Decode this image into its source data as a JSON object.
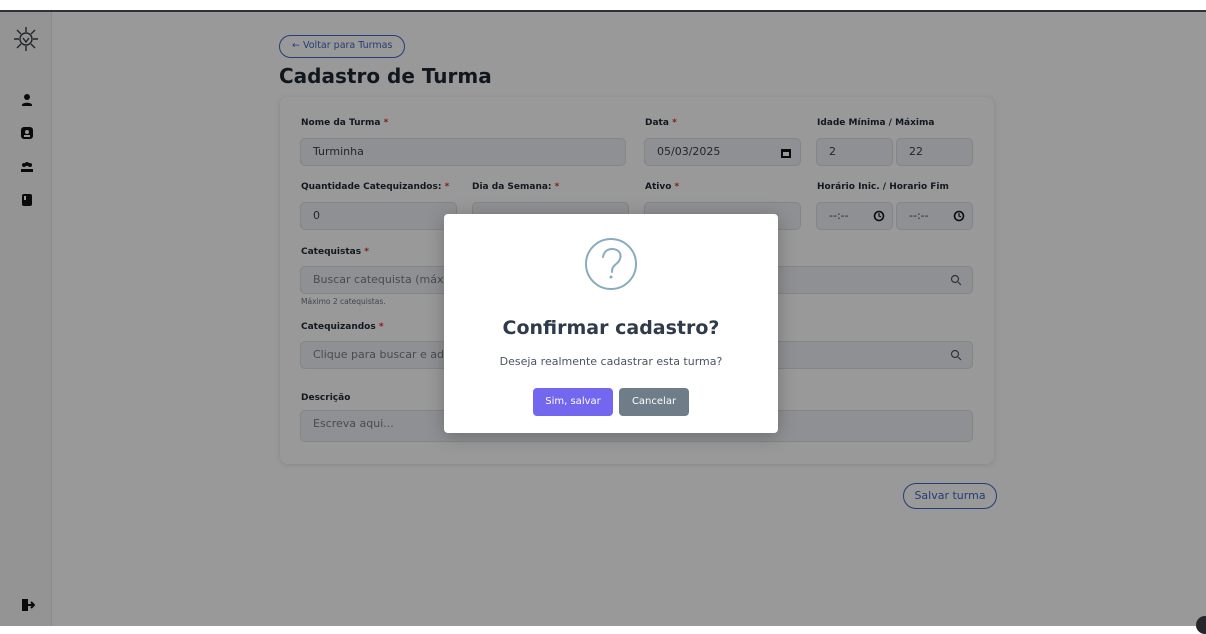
{
  "page": {
    "back_label": "← Voltar para Turmas",
    "title": "Cadastro de Turma",
    "save_label": "Salvar turma"
  },
  "form": {
    "nome": {
      "label": "Nome da Turma",
      "value": "Turminha"
    },
    "data": {
      "label": "Data",
      "value": "05/03/2025"
    },
    "idade": {
      "label": "Idade Mínima / Máxima",
      "min_value": "2",
      "max_value": "22"
    },
    "quantidade": {
      "label": "Quantidade Catequizandos:",
      "value": "0"
    },
    "dia": {
      "label": "Dia da Semana:",
      "value": ""
    },
    "ativo": {
      "label": "Ativo",
      "value": ""
    },
    "horario": {
      "label": "Horário Inic. / Horario Fim",
      "start_value": "--:--",
      "end_value": "--:--"
    },
    "catequistas": {
      "label": "Catequistas",
      "placeholder": "Buscar catequista (máx 2)",
      "hint": "Máximo 2 catequistas."
    },
    "catequizandos": {
      "label": "Catequizandos",
      "placeholder": "Clique para buscar e adicionar"
    },
    "descricao": {
      "label": "Descrição",
      "placeholder": "Escreva aqui..."
    },
    "required_marker": "*"
  },
  "modal": {
    "icon": "question-icon",
    "title": "Confirmar cadastro?",
    "message": "Deseja realmente cadastrar esta turma?",
    "confirm_label": "Sim, salvar",
    "cancel_label": "Cancelar"
  },
  "sidebar": {
    "items": [
      {
        "icon": "user-icon"
      },
      {
        "icon": "profile-icon"
      },
      {
        "icon": "group-icon"
      },
      {
        "icon": "book-icon"
      }
    ],
    "logout_icon": "logout-icon"
  },
  "colors": {
    "primary": "#3b67c9",
    "confirm": "#7367f0",
    "cancel": "#6e7d88",
    "required": "#d93025",
    "modal_icon": "#87adbd"
  }
}
